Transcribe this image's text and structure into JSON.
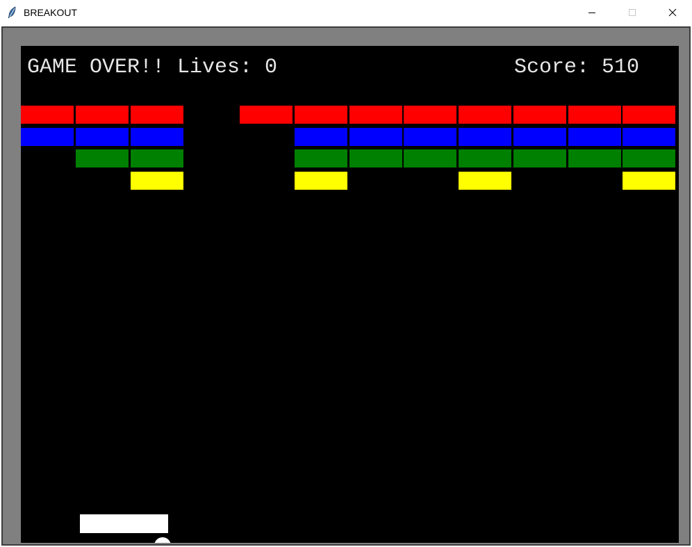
{
  "window": {
    "title": "BREAKOUT",
    "icons": {
      "app": "feather-icon",
      "minimize": "minimize-icon",
      "maximize": "maximize-icon",
      "close": "close-icon"
    }
  },
  "hud": {
    "status_text": "GAME OVER!! Lives: 0",
    "score_text": "Score: 510"
  },
  "colors": {
    "background": "#000000",
    "frame": "#808080",
    "text": "#e6e6e6",
    "paddle": "#ffffff",
    "ball": "#ffffff",
    "rows": [
      "#ff0000",
      "#0000ff",
      "#008000",
      "#ffff00"
    ]
  },
  "bricks": {
    "columns": 12,
    "rows": [
      {
        "color": "red",
        "present": [
          1,
          1,
          1,
          0,
          1,
          1,
          1,
          1,
          1,
          1,
          1,
          1
        ]
      },
      {
        "color": "blue",
        "present": [
          1,
          1,
          1,
          0,
          0,
          1,
          1,
          1,
          1,
          1,
          1,
          1
        ]
      },
      {
        "color": "green",
        "present": [
          0,
          1,
          1,
          0,
          0,
          1,
          1,
          1,
          1,
          1,
          1,
          1
        ]
      },
      {
        "color": "yellow",
        "present": [
          0,
          0,
          1,
          0,
          0,
          1,
          0,
          0,
          1,
          0,
          0,
          1
        ]
      }
    ]
  }
}
